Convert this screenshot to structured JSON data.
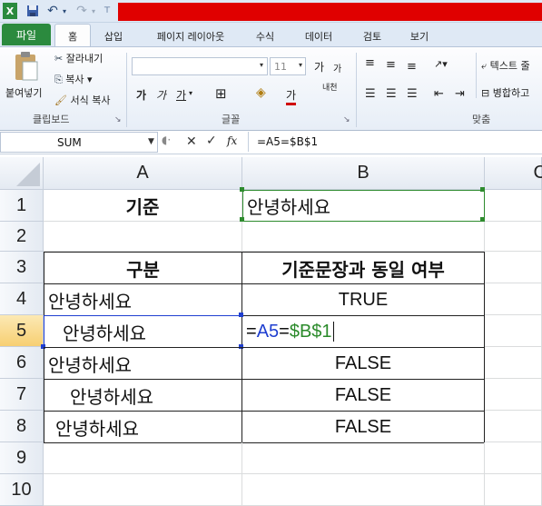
{
  "quick_access": {
    "save": "save-icon",
    "undo": "↶",
    "redo": "↷"
  },
  "tabs": [
    "파일",
    "홈",
    "삽입",
    "페이지 레이아웃",
    "수식",
    "데이터",
    "검토",
    "보기"
  ],
  "clipboard": {
    "paste": "붙여넣기",
    "cut": "잘라내기",
    "copy": "복사 ▾",
    "format_painter": "서식 복사",
    "group": "클립보드"
  },
  "font": {
    "size": "11",
    "grow": "가",
    "shrink": "가",
    "bold": "가",
    "italic": "가",
    "underline": "가",
    "color_letter": "가",
    "phonetic": "내천",
    "group": "글꼴"
  },
  "alignment": {
    "wrap_text": "텍스트 줄",
    "merge": "병합하고",
    "group": "맞춤"
  },
  "formula_bar": {
    "name_box": "SUM",
    "fx": "fx",
    "formula": "=A5=$B$1"
  },
  "columns": [
    "A",
    "B",
    "C"
  ],
  "rows": [
    {
      "num": "1",
      "a": "기준",
      "b": "안녕하세요"
    },
    {
      "num": "2",
      "a": "",
      "b": ""
    },
    {
      "num": "3",
      "a": "구분",
      "b": "기준문장과 동일 여부"
    },
    {
      "num": "4",
      "a": "안녕하세요",
      "b": "TRUE"
    },
    {
      "num": "5",
      "a": "안녕하세요",
      "b": ""
    },
    {
      "num": "6",
      "a": "안녕하세요",
      "b": "FALSE"
    },
    {
      "num": "7",
      "a": "안녕하세요",
      "b": "FALSE"
    },
    {
      "num": "8",
      "a": "안녕하세요",
      "b": "FALSE"
    },
    {
      "num": "9",
      "a": "",
      "b": ""
    },
    {
      "num": "10",
      "a": "",
      "b": ""
    }
  ],
  "editing": {
    "eq1": "=",
    "ref1": "A5",
    "eq2": "=",
    "ref2": "$B$1"
  },
  "colors": {
    "ref1": "#1f3fd0",
    "ref2": "#2a8a2a",
    "selection": "#f7cf72",
    "file_tab": "#2b8a3e"
  }
}
